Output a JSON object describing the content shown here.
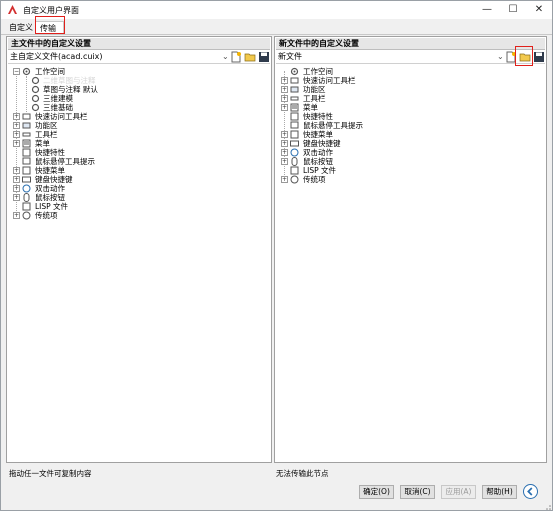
{
  "window": {
    "title": "自定义用户界面",
    "minimize": "—",
    "maximize": "☐",
    "close": "✕"
  },
  "tabs": [
    {
      "label": "自定义"
    },
    {
      "label": "传输"
    }
  ],
  "left_panel": {
    "header": "主文件中的自定义设置",
    "file": "主自定义文件(acad.cuix)",
    "tree": [
      {
        "label": "工作空间"
      },
      {
        "label": "二维草图与注释"
      },
      {
        "label": "草图与注释 默认"
      },
      {
        "label": "三维建模"
      },
      {
        "label": "三维基础"
      },
      {
        "label": "快速访问工具栏"
      },
      {
        "label": "功能区"
      },
      {
        "label": "工具栏"
      },
      {
        "label": "菜单"
      },
      {
        "label": "快捷特性"
      },
      {
        "label": "鼠标悬停工具提示"
      },
      {
        "label": "快捷菜单"
      },
      {
        "label": "键盘快捷键"
      },
      {
        "label": "双击动作"
      },
      {
        "label": "鼠标按钮"
      },
      {
        "label": "LISP 文件"
      },
      {
        "label": "传统项"
      }
    ]
  },
  "right_panel": {
    "header": "新文件中的自定义设置",
    "file": "新文件",
    "tree": [
      {
        "label": "工作空间"
      },
      {
        "label": "快速访问工具栏"
      },
      {
        "label": "功能区"
      },
      {
        "label": "工具栏"
      },
      {
        "label": "菜单"
      },
      {
        "label": "快捷特性"
      },
      {
        "label": "鼠标悬停工具提示"
      },
      {
        "label": "快捷菜单"
      },
      {
        "label": "键盘快捷键"
      },
      {
        "label": "双击动作"
      },
      {
        "label": "鼠标按钮"
      },
      {
        "label": "LISP 文件"
      },
      {
        "label": "传统项"
      }
    ]
  },
  "status": {
    "left": "拖动任一文件可复制内容",
    "right": "无法传输此节点"
  },
  "buttons": {
    "ok": "确定(O)",
    "cancel": "取消(C)",
    "apply": "应用(A)",
    "help": "帮助(H)"
  },
  "colors": {
    "highlight": "#e0201b",
    "accent": "#2a6fb0"
  }
}
